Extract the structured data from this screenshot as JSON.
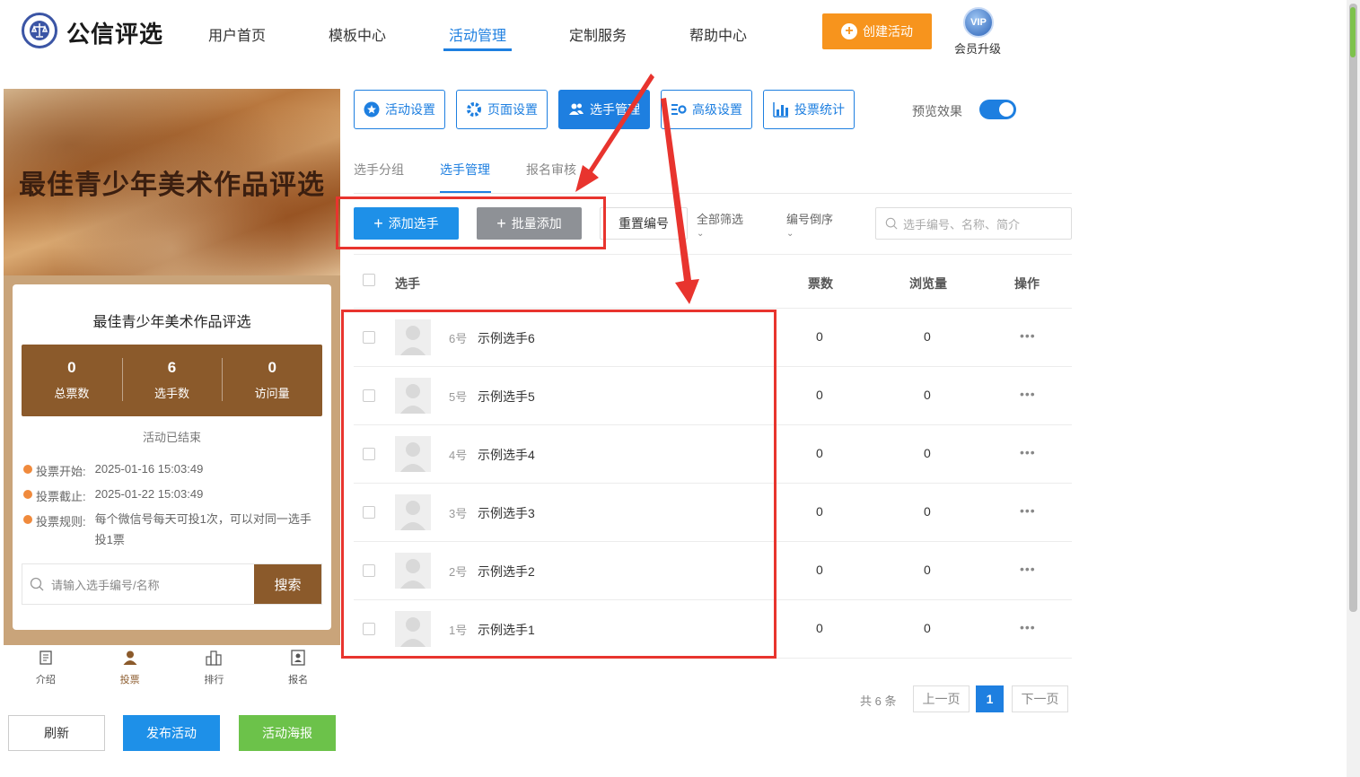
{
  "header": {
    "logo_text": "公信评选",
    "nav": [
      "用户首页",
      "模板中心",
      "活动管理",
      "定制服务",
      "帮助中心"
    ],
    "create_button": "创建活动",
    "vip_badge": "VIP",
    "vip_label": "会员升级"
  },
  "preview": {
    "banner_title": "最佳青少年美术作品评选",
    "card_title": "最佳青少年美术作品评选",
    "stats": [
      {
        "value": "0",
        "label": "总票数"
      },
      {
        "value": "6",
        "label": "选手数"
      },
      {
        "value": "0",
        "label": "访问量"
      }
    ],
    "status": "活动已结束",
    "info": [
      {
        "key": "投票开始:",
        "value": "2025-01-16 15:03:49"
      },
      {
        "key": "投票截止:",
        "value": "2025-01-22 15:03:49"
      },
      {
        "key": "投票规则:",
        "value": "每个微信号每天可投1次，可以对同一选手投1票"
      }
    ],
    "search_placeholder": "请输入选手编号/名称",
    "search_button": "搜索",
    "tabbar": [
      "介绍",
      "投票",
      "排行",
      "报名"
    ]
  },
  "bottom_buttons": {
    "refresh": "刷新",
    "publish": "发布活动",
    "poster": "活动海报"
  },
  "toolbar": {
    "buttons": [
      "活动设置",
      "页面设置",
      "选手管理",
      "高级设置",
      "投票统计"
    ],
    "preview_label": "预览效果"
  },
  "subtabs": [
    "选手分组",
    "选手管理",
    "报名审核"
  ],
  "actions": {
    "add": "添加选手",
    "batch_add": "批量添加",
    "reset_number": "重置编号",
    "filter_all": "全部筛选",
    "sort_desc": "编号倒序",
    "search_placeholder": "选手编号、名称、简介"
  },
  "table": {
    "headers": [
      "选手",
      "票数",
      "浏览量",
      "操作"
    ],
    "rows": [
      {
        "num": "6号",
        "name": "示例选手6",
        "votes": "0",
        "views": "0",
        "op": "•••"
      },
      {
        "num": "5号",
        "name": "示例选手5",
        "votes": "0",
        "views": "0",
        "op": "•••"
      },
      {
        "num": "4号",
        "name": "示例选手4",
        "votes": "0",
        "views": "0",
        "op": "•••"
      },
      {
        "num": "3号",
        "name": "示例选手3",
        "votes": "0",
        "views": "0",
        "op": "•••"
      },
      {
        "num": "2号",
        "name": "示例选手2",
        "votes": "0",
        "views": "0",
        "op": "•••"
      },
      {
        "num": "1号",
        "name": "示例选手1",
        "votes": "0",
        "views": "0",
        "op": "•••"
      }
    ]
  },
  "pagination": {
    "total": "共 6 条",
    "prev": "上一页",
    "current": "1",
    "next": "下一页"
  },
  "colors": {
    "primary": "#1e7fe0",
    "orange": "#f7941d",
    "brown": "#8b5a2b",
    "green": "#6cc24a",
    "red_annotation": "#e8342e"
  }
}
